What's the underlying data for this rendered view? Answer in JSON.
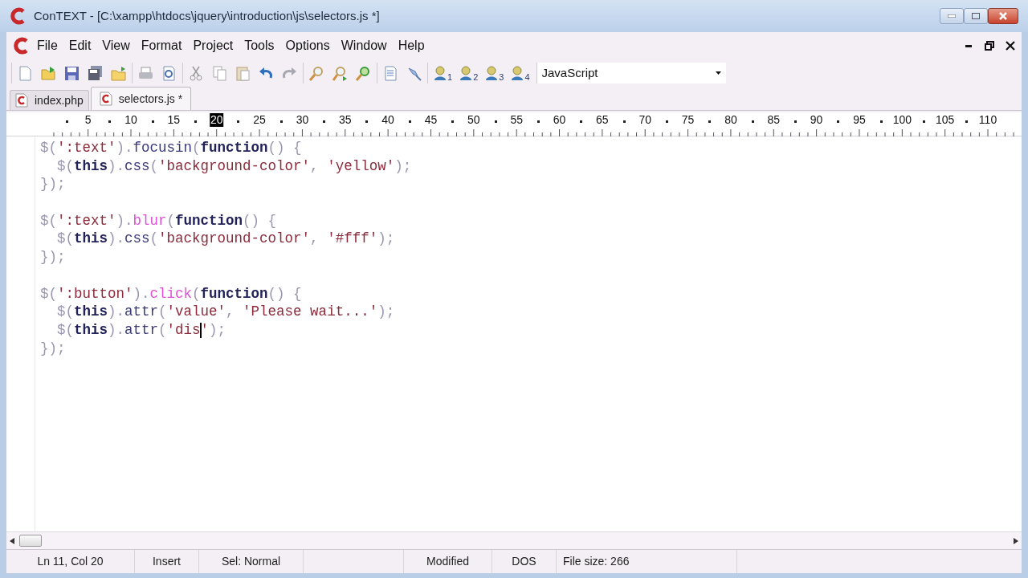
{
  "window": {
    "title": "ConTEXT - [C:\\xampp\\htdocs\\jquery\\introduction\\js\\selectors.js *]"
  },
  "menu": [
    "File",
    "Edit",
    "View",
    "Format",
    "Project",
    "Tools",
    "Options",
    "Window",
    "Help"
  ],
  "toolbar": {
    "groups": [
      [
        {
          "kind": "new"
        },
        {
          "kind": "open"
        },
        {
          "kind": "save"
        },
        {
          "kind": "saveall"
        },
        {
          "kind": "folder"
        }
      ],
      [
        {
          "kind": "print"
        },
        {
          "kind": "preview"
        }
      ],
      [
        {
          "kind": "cut"
        },
        {
          "kind": "copy"
        },
        {
          "kind": "paste"
        },
        {
          "kind": "undo"
        },
        {
          "kind": "redo"
        }
      ],
      [
        {
          "kind": "find"
        },
        {
          "kind": "findnext"
        },
        {
          "kind": "replace"
        }
      ],
      [
        {
          "kind": "document"
        },
        {
          "kind": "pin"
        }
      ],
      [
        {
          "kind": "user",
          "label": "1"
        },
        {
          "kind": "user",
          "label": "2"
        },
        {
          "kind": "user",
          "label": "3"
        },
        {
          "kind": "user",
          "label": "4"
        }
      ]
    ],
    "language": "JavaScript"
  },
  "tabs": [
    {
      "label": "index.php",
      "selected": false
    },
    {
      "label": "selectors.js *",
      "selected": true
    }
  ],
  "ruler": [
    {
      "label": "5",
      "current": false
    },
    {
      "label": "10",
      "current": false
    },
    {
      "label": "15",
      "current": false
    },
    {
      "label": "20",
      "current": true
    },
    {
      "label": "25",
      "current": false
    },
    {
      "label": "30",
      "current": false
    },
    {
      "label": "35",
      "current": false
    },
    {
      "label": "40",
      "current": false
    },
    {
      "label": "45",
      "current": false
    },
    {
      "label": "50",
      "current": false
    },
    {
      "label": "55",
      "current": false
    },
    {
      "label": "60",
      "current": false
    },
    {
      "label": "65",
      "current": false
    },
    {
      "label": "70",
      "current": false
    },
    {
      "label": "75",
      "current": false
    },
    {
      "label": "80",
      "current": false
    },
    {
      "label": "85",
      "current": false
    },
    {
      "label": "90",
      "current": false
    },
    {
      "label": "95",
      "current": false
    },
    {
      "label": "100",
      "current": false
    },
    {
      "label": "105",
      "current": false
    },
    {
      "label": "110",
      "current": false
    }
  ],
  "code_blocks": [
    [
      {
        "indented": false,
        "tokens": [
          {
            "text": "$(",
            "kind": "sym"
          },
          {
            "text": "':text'",
            "kind": "str"
          },
          {
            "text": ").",
            "kind": "sym"
          },
          {
            "text": "focusin",
            "kind": "ident"
          },
          {
            "text": "(",
            "kind": "sym"
          },
          {
            "text": "function",
            "kind": "kw"
          },
          {
            "text": "() {",
            "kind": "sym"
          }
        ]
      },
      {
        "indented": true,
        "tokens": [
          {
            "text": "$(",
            "kind": "sym"
          },
          {
            "text": "this",
            "kind": "kw"
          },
          {
            "text": ").",
            "kind": "sym"
          },
          {
            "text": "css",
            "kind": "ident"
          },
          {
            "text": "(",
            "kind": "sym"
          },
          {
            "text": "'background-color'",
            "kind": "str"
          },
          {
            "text": ", ",
            "kind": "sym"
          },
          {
            "text": "'yellow'",
            "kind": "str"
          },
          {
            "text": ");",
            "kind": "sym"
          }
        ]
      },
      {
        "indented": false,
        "tokens": [
          {
            "text": "});",
            "kind": "sym"
          }
        ]
      }
    ],
    [
      {
        "indented": false,
        "tokens": [
          {
            "text": "$(",
            "kind": "sym"
          },
          {
            "text": "':text'",
            "kind": "str"
          },
          {
            "text": ").",
            "kind": "sym"
          },
          {
            "text": "blur",
            "kind": "event"
          },
          {
            "text": "(",
            "kind": "sym"
          },
          {
            "text": "function",
            "kind": "kw"
          },
          {
            "text": "() {",
            "kind": "sym"
          }
        ]
      },
      {
        "indented": true,
        "tokens": [
          {
            "text": "$(",
            "kind": "sym"
          },
          {
            "text": "this",
            "kind": "kw"
          },
          {
            "text": ").",
            "kind": "sym"
          },
          {
            "text": "css",
            "kind": "ident"
          },
          {
            "text": "(",
            "kind": "sym"
          },
          {
            "text": "'background-color'",
            "kind": "str"
          },
          {
            "text": ", ",
            "kind": "sym"
          },
          {
            "text": "'#fff'",
            "kind": "str"
          },
          {
            "text": ");",
            "kind": "sym"
          }
        ]
      },
      {
        "indented": false,
        "tokens": [
          {
            "text": "});",
            "kind": "sym"
          }
        ]
      }
    ],
    [
      {
        "indented": false,
        "tokens": [
          {
            "text": "$(",
            "kind": "sym"
          },
          {
            "text": "':button'",
            "kind": "str"
          },
          {
            "text": ").",
            "kind": "sym"
          },
          {
            "text": "click",
            "kind": "event"
          },
          {
            "text": "(",
            "kind": "sym"
          },
          {
            "text": "function",
            "kind": "kw"
          },
          {
            "text": "() {",
            "kind": "sym"
          }
        ]
      },
      {
        "indented": true,
        "tokens": [
          {
            "text": "$(",
            "kind": "sym"
          },
          {
            "text": "this",
            "kind": "kw"
          },
          {
            "text": ").",
            "kind": "sym"
          },
          {
            "text": "attr",
            "kind": "ident"
          },
          {
            "text": "(",
            "kind": "sym"
          },
          {
            "text": "'value'",
            "kind": "str"
          },
          {
            "text": ", ",
            "kind": "sym"
          },
          {
            "text": "'Please wait...'",
            "kind": "str"
          },
          {
            "text": ");",
            "kind": "sym"
          }
        ]
      },
      {
        "indented": true,
        "tokens": [
          {
            "text": "$(",
            "kind": "sym"
          },
          {
            "text": "this",
            "kind": "kw"
          },
          {
            "text": ").",
            "kind": "sym"
          },
          {
            "text": "attr",
            "kind": "ident"
          },
          {
            "text": "(",
            "kind": "sym"
          },
          {
            "text": "'dis",
            "kind": "str",
            "caret_after": true
          },
          {
            "text": "'",
            "kind": "str"
          },
          {
            "text": ");",
            "kind": "sym"
          }
        ]
      },
      {
        "indented": false,
        "tokens": [
          {
            "text": "});",
            "kind": "sym"
          }
        ]
      }
    ]
  ],
  "status_bar": [
    "Ln 11, Col 20",
    "Insert",
    "Sel: Normal",
    "Modified",
    "DOS",
    "File size: 266"
  ]
}
